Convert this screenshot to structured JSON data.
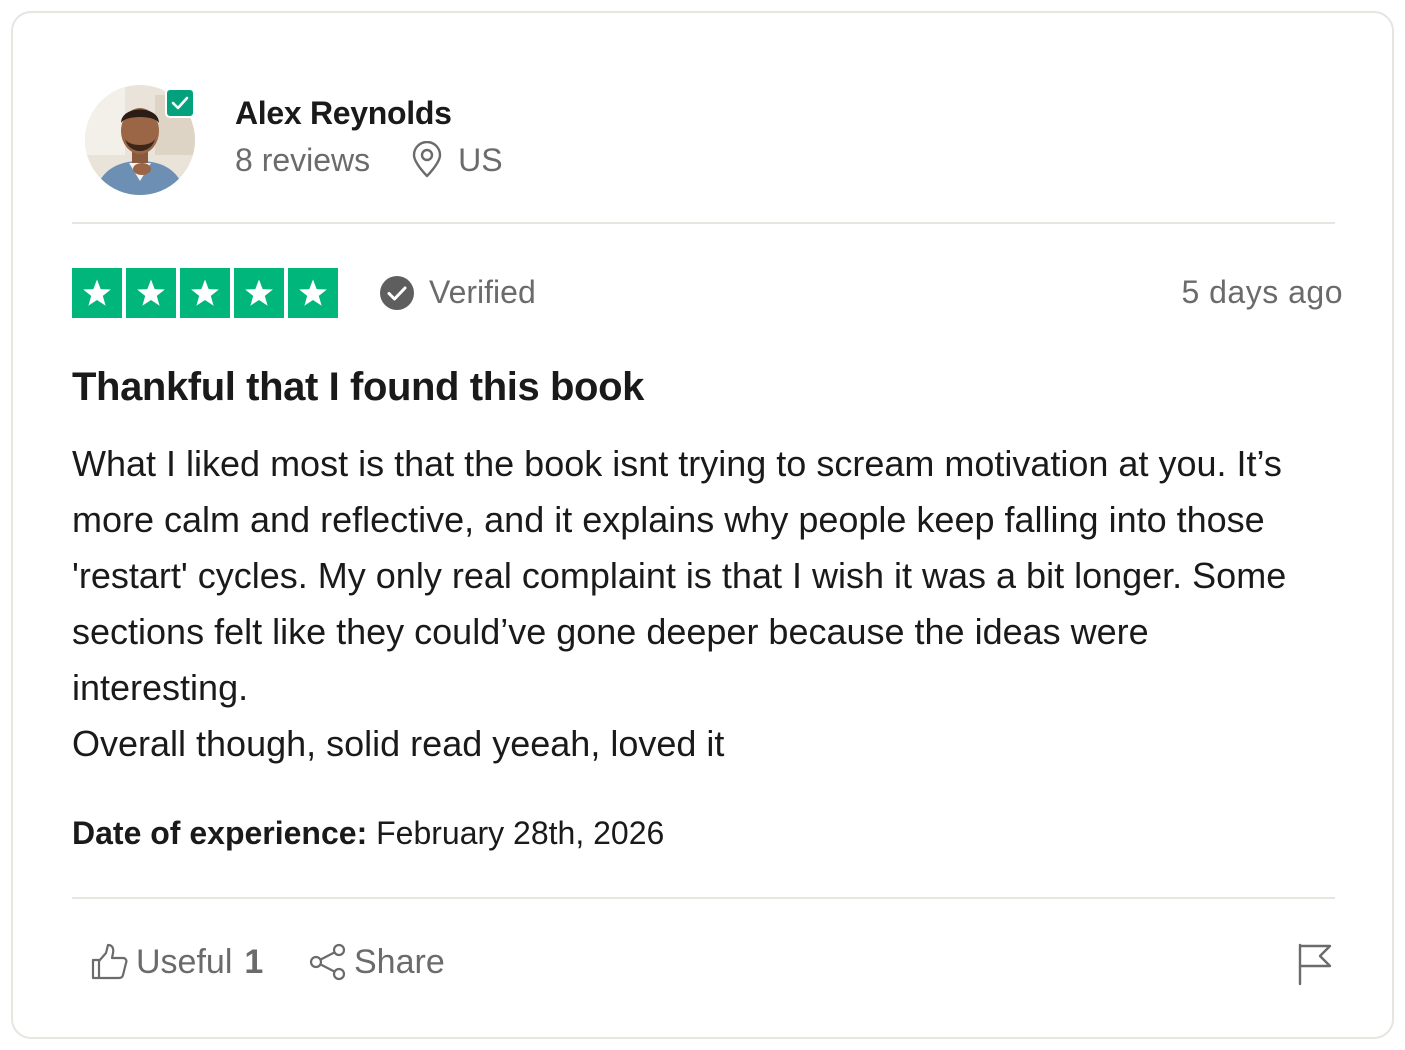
{
  "reviewer": {
    "name": "Alex Reynolds",
    "reviews_count": "8 reviews",
    "country": "US",
    "avatar_icon": "user-avatar-photo",
    "verified_badge_icon": "check-badge-icon"
  },
  "rating": {
    "stars": 5,
    "max_stars": 5,
    "star_color": "#00b67a",
    "verified_label": "Verified",
    "age": "5 days ago"
  },
  "review": {
    "title": "Thankful that I found this book",
    "body": "What I liked most is that the book isnt trying to scream motivation at you. It’s more calm and reflective, and it explains why people keep falling into those 'restart' cycles. My only real complaint is that I wish it was a bit longer. Some sections felt like they could’ve gone deeper because the ideas were interesting.\nOverall though, solid read yeeah, loved it"
  },
  "experience": {
    "label": "Date of experience:",
    "date": "February 28th, 2026"
  },
  "actions": {
    "useful_label": "Useful",
    "useful_count": "1",
    "share_label": "Share",
    "useful_icon": "thumbs-up-icon",
    "share_icon": "share-icon",
    "flag_icon": "flag-icon"
  },
  "colors": {
    "accent_green": "#00b67a",
    "badge_green": "#04a27c",
    "muted_text": "#6b6b6b",
    "divider": "#e6e5df"
  }
}
